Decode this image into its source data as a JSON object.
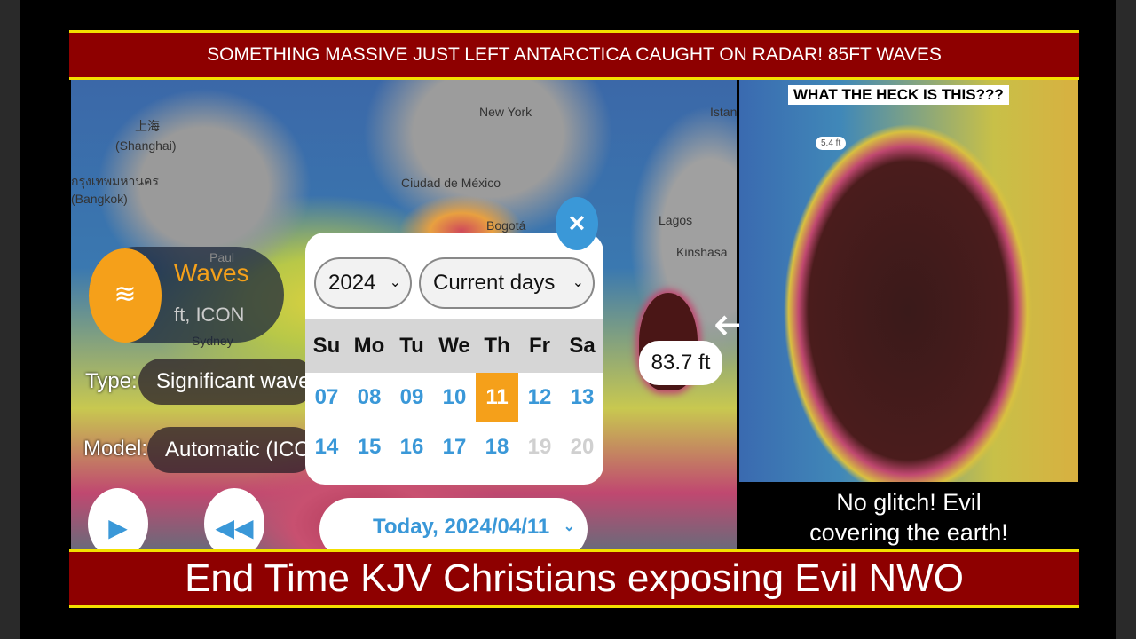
{
  "top_banner": "SOMETHING MASSIVE JUST LEFT ANTARCTICA CAUGHT ON RADAR! 85FT WAVES",
  "bottom_banner": "End Time KJV Christians exposing Evil NWO",
  "map": {
    "labels": [
      "上海",
      "(Shanghai)",
      "กรุงเทพมหานคร",
      "(Bangkok)",
      "New York",
      "Ciudad de México",
      "Bogotá",
      "Lagos",
      "Kinshasa",
      "Istan",
      "Paul",
      "Sydney"
    ],
    "layer": {
      "title": "Waves",
      "subtitle": "ft, ICON",
      "icon": "waves-icon"
    },
    "type_label": "Type:",
    "type_value": "Significant wave h",
    "model_label": "Model:",
    "model_value": "Automatic (ICON",
    "wave_height": "83.7 ft",
    "today": "Today, 2024/04/11",
    "accent": "#3a98d8",
    "highlight": "#f5a01a"
  },
  "calendar": {
    "year": "2024",
    "range": "Current days",
    "weekdays": [
      "Su",
      "Mo",
      "Tu",
      "We",
      "Th",
      "Fr",
      "Sa"
    ],
    "week1": [
      "07",
      "08",
      "09",
      "10",
      "11",
      "12",
      "13"
    ],
    "week2": [
      "14",
      "15",
      "16",
      "17",
      "18",
      "19",
      "20"
    ],
    "selected": "11",
    "disabled": [
      "19",
      "20"
    ]
  },
  "right_panel": {
    "heading": "WHAT THE HECK IS THIS???",
    "small_label": "5.4 ft",
    "caption_line1": "No glitch! Evil",
    "caption_line2": "covering the earth!"
  }
}
